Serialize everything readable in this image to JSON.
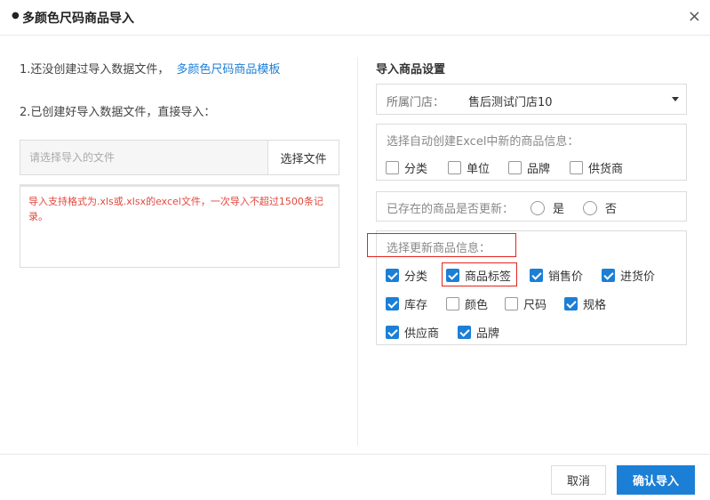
{
  "dialog": {
    "title": "多颜色尺码商品导入",
    "close_symbol": "×"
  },
  "left": {
    "step1_text": "1.还没创建过导入数据文件，",
    "template_link": "多颜色尺码商品模板",
    "step2_text": "2.已创建好导入数据文件，直接导入：",
    "file_placeholder": "请选择导入的文件",
    "choose_file_label": "选择文件",
    "notice_text": "导入支持格式为.xls或.xlsx的excel文件，一次导入不超过1500条记录。"
  },
  "right": {
    "settings_title": "导入商品设置",
    "store_label": "所属门店：",
    "store_value": "售后测试门店10",
    "auto_create_title": "选择自动创建Excel中新的商品信息：",
    "auto_create_options": [
      {
        "label": "分类",
        "checked": false
      },
      {
        "label": "单位",
        "checked": false
      },
      {
        "label": "品牌",
        "checked": false
      },
      {
        "label": "供货商",
        "checked": false
      }
    ],
    "update_existing_label": "已存在的商品是否更新：",
    "update_existing_options": [
      {
        "label": "是"
      },
      {
        "label": "否"
      }
    ],
    "update_fields_title": "选择更新商品信息：",
    "update_fields": [
      {
        "label": "分类",
        "checked": true
      },
      {
        "label": "商品标签",
        "checked": true
      },
      {
        "label": "销售价",
        "checked": true
      },
      {
        "label": "进货价",
        "checked": true
      },
      {
        "label": "库存",
        "checked": true
      },
      {
        "label": "颜色",
        "checked": false
      },
      {
        "label": "尺码",
        "checked": false
      },
      {
        "label": "规格",
        "checked": true
      },
      {
        "label": "供应商",
        "checked": true
      },
      {
        "label": "品牌",
        "checked": true
      }
    ]
  },
  "footer": {
    "cancel_label": "取消",
    "confirm_label": "确认导入"
  },
  "colors": {
    "accent": "#1c7fd6",
    "notice_text": "#e0483e",
    "highlight_outline": "#e3241c"
  }
}
